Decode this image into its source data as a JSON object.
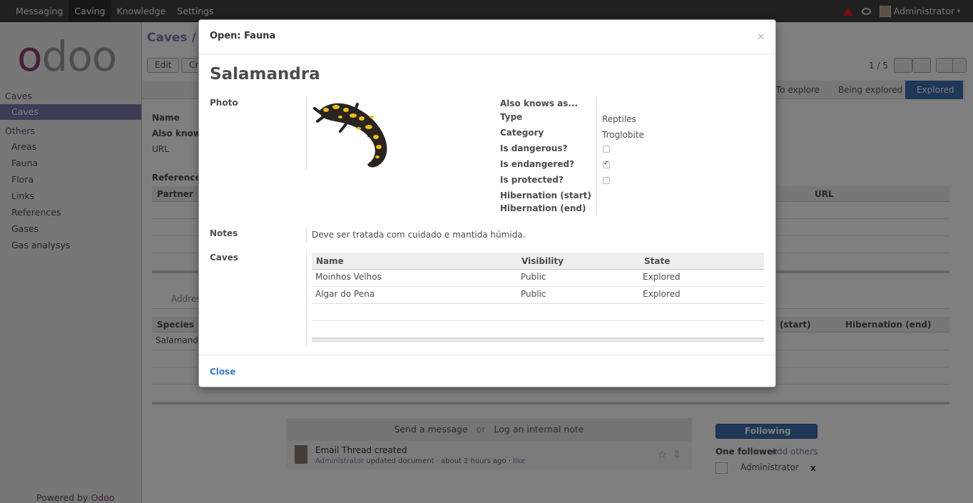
{
  "topbar": {
    "menu": [
      "Messaging",
      "Caving",
      "Knowledge",
      "Settings"
    ],
    "active_menu": "Caving",
    "user": "Administrator"
  },
  "sidebar": {
    "section1": "Caves",
    "items1": [
      "Caves"
    ],
    "section2": "Others",
    "items2": [
      "Areas",
      "Fauna",
      "Flora",
      "Links",
      "References",
      "Gases",
      "Gas analysys"
    ],
    "powered_by": "Powered by",
    "powered_brand": "Odoo"
  },
  "background": {
    "breadcrumb": "Caves / M",
    "edit_button": "Edit",
    "create_button": "Cr",
    "pager": "1 / 5",
    "states": [
      "To explore",
      "Being explored",
      "Explored"
    ],
    "labels": {
      "name": "Name",
      "also_known": "Also know a",
      "url": "URL",
      "references": "References"
    },
    "ref_cols": {
      "partner": "Partner",
      "url": "URL"
    },
    "address_tab": "Addres",
    "species_cols": {
      "species": "Species",
      "hib_start": "(start)",
      "hib_end": "Hibernation (end)"
    },
    "species_row": "Salamandr",
    "chatter": {
      "send_message": "Send a message",
      "or": "or",
      "log_note": "Log an internal note",
      "thread_title": "Email Thread created",
      "thread_author": "Administrator",
      "thread_meta": "updated document · about 2 hours ago ·",
      "thread_like": "like",
      "following": "Following",
      "one_follower": "One follower",
      "add_others": "Add others",
      "follower_name": "Administrator",
      "remove": "x"
    }
  },
  "modal": {
    "title": "Open: Fauna",
    "close_x": "×",
    "record_name": "Salamandra",
    "fields": {
      "photo_label": "Photo",
      "also_knows_label": "Also knows as...",
      "type_label": "Type",
      "type_value": "Reptiles",
      "category_label": "Category",
      "category_value": "Troglobite",
      "dangerous_label": "Is dangerous?",
      "dangerous": false,
      "endangered_label": "Is endangered?",
      "endangered": true,
      "protected_label": "Is protected?",
      "protected": false,
      "hib_start_label": "Hibernation (start)",
      "hib_end_label": "Hibernation (end)",
      "notes_label": "Notes",
      "notes_value": "Deve ser tratada com cuidado e mantida húmida.",
      "caves_label": "Caves"
    },
    "caves_table": {
      "columns": [
        "Name",
        "Visibility",
        "State"
      ],
      "rows": [
        {
          "name": "Moinhos Velhos",
          "visibility": "Public",
          "state": "Explored"
        },
        {
          "name": "Algar do Pena",
          "visibility": "Public",
          "state": "Explored"
        }
      ]
    },
    "close_button": "Close"
  }
}
